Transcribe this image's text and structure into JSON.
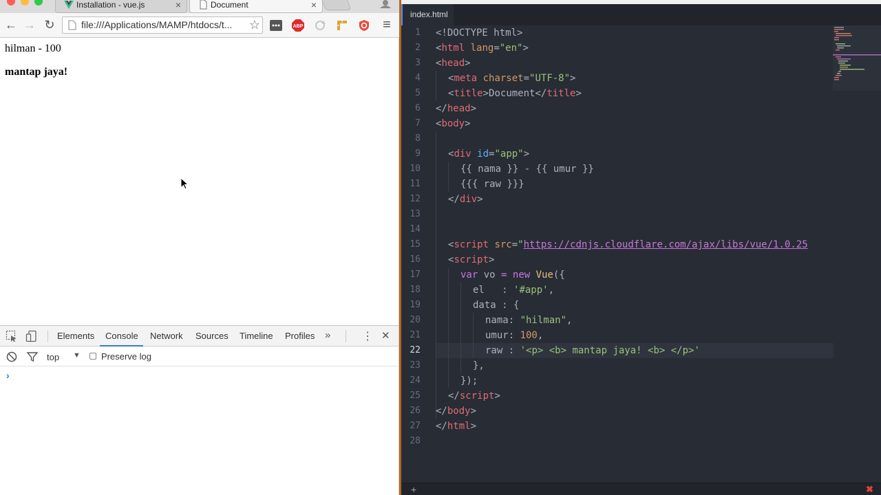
{
  "browser": {
    "tabs": [
      {
        "title": "Installation - vue.js",
        "close": "×",
        "active": false
      },
      {
        "title": "Document",
        "close": "×",
        "active": true
      }
    ],
    "nav": {
      "back": "←",
      "forward": "→",
      "reload": "↻",
      "menu": "≡"
    },
    "url": "file:///Applications/MAMP/htdocs/t...",
    "star": "☆",
    "page": {
      "line1": "hilman - 100",
      "line2": "mantap jaya!"
    }
  },
  "devtools": {
    "tabs": [
      "Elements",
      "Console",
      "Network",
      "Sources",
      "Timeline",
      "Profiles"
    ],
    "more": "»",
    "close": "✕",
    "kebab": "⋮",
    "context": "top",
    "context_arrow": "▼",
    "preserve_log": "Preserve log",
    "prompt": "›"
  },
  "editor": {
    "file_tab": "index.html",
    "current_line": 22,
    "status_plus": "+",
    "status_x": "✖",
    "lines": [
      "1",
      "2",
      "3",
      "4",
      "5",
      "6",
      "7",
      "8",
      "9",
      "10",
      "11",
      "12",
      "13",
      "14",
      "15",
      "16",
      "17",
      "18",
      "19",
      "20",
      "21",
      "22",
      "23",
      "24",
      "25",
      "26",
      "27",
      "28"
    ],
    "code": {
      "l1": "<!DOCTYPE html>",
      "l2a": "<",
      "l2b": "html",
      "l2c": " lang",
      "l2d": "=",
      "l2e": "\"en\"",
      "l2f": ">",
      "l3a": "<",
      "l3b": "head",
      "l3c": ">",
      "l4a": "<",
      "l4b": "meta",
      "l4c": " charset",
      "l4d": "=",
      "l4e": "\"UTF-8\"",
      "l4f": ">",
      "l5a": "<",
      "l5b": "title",
      "l5c": ">",
      "l5d": "Document",
      "l5e": "</",
      "l5f": "title",
      "l5g": ">",
      "l6a": "</",
      "l6b": "head",
      "l6c": ">",
      "l7a": "<",
      "l7b": "body",
      "l7c": ">",
      "l9a": "<",
      "l9b": "div",
      "l9c": " id",
      "l9d": "=",
      "l9e": "\"app\"",
      "l9f": ">",
      "l10": "{{ nama }} - {{ umur }}",
      "l11": "{{{ raw }}}",
      "l12a": "</",
      "l12b": "div",
      "l12c": ">",
      "l15a": "<",
      "l15b": "script",
      "l15c": " src",
      "l15d": "=",
      "l15e": "\"",
      "l15f": "https://cdnjs.cloudflare.com/ajax/libs/vue/1.0.25",
      "l16a": "<",
      "l16b": "script",
      "l16c": ">",
      "l17a": "var",
      "l17b": " vo ",
      "l17c": "=",
      "l17d": " ",
      "l17e": "new",
      "l17f": " ",
      "l17g": "Vue",
      "l17h": "({",
      "l18a": "el",
      "l18b": "   : ",
      "l18c": "'#app'",
      "l18d": ",",
      "l19a": "data",
      "l19b": " : {",
      "l20a": "nama",
      "l20b": ": ",
      "l20c": "\"hilman\"",
      "l20d": ",",
      "l21a": "umur",
      "l21b": ": ",
      "l21c": "100",
      "l21d": ",",
      "l22a": "raw",
      "l22b": " : ",
      "l22c": "'<p> <b> mantap jaya! <b> </p>'",
      "l23": "},",
      "l24": "});",
      "l25a": "</",
      "l25b": "script",
      "l25c": ">",
      "l26a": "</",
      "l26b": "body",
      "l26c": ">",
      "l27a": "</",
      "l27b": "html",
      "l27c": ">"
    }
  },
  "colors": {
    "editor_bg": "#282c34",
    "tag": "#e06c75",
    "attr": "#d19a66",
    "string": "#98c379",
    "keyword": "#c678dd",
    "accent": "#3879d9"
  }
}
